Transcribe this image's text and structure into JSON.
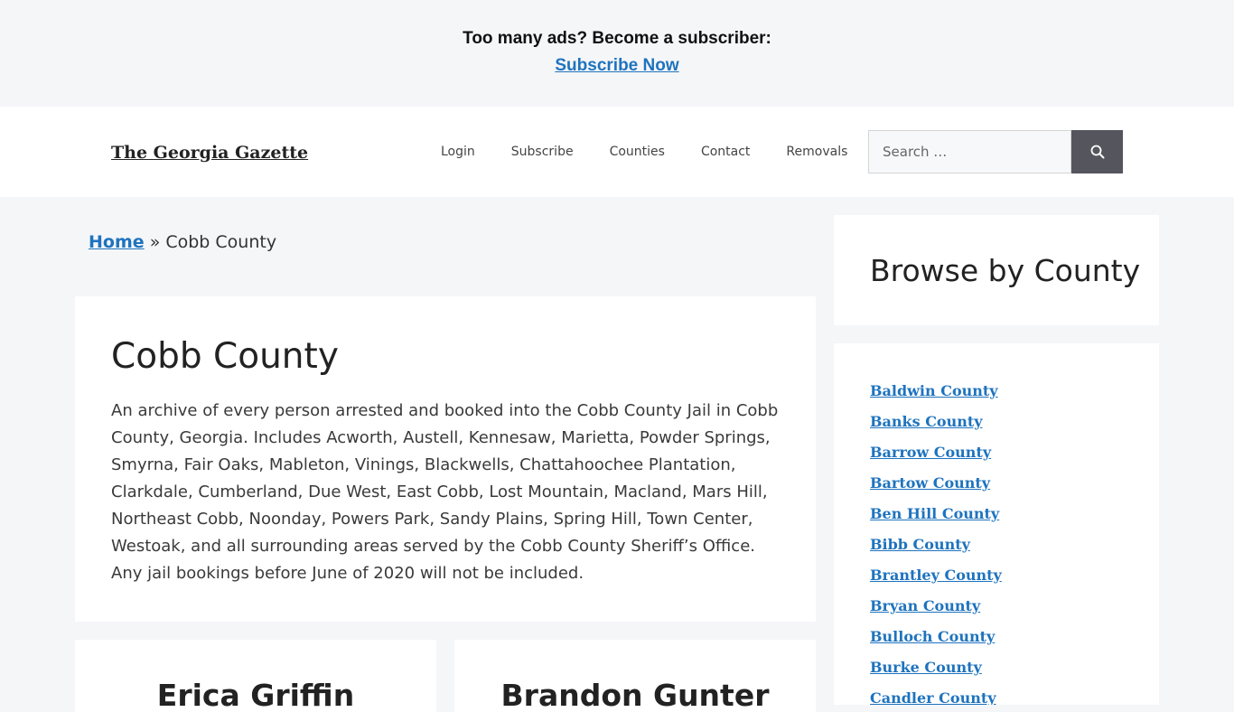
{
  "banner": {
    "text": "Too many ads? Become a subscriber:",
    "link_label": "Subscribe Now"
  },
  "header": {
    "site_title": "The Georgia Gazette",
    "nav": [
      "Login",
      "Subscribe",
      "Counties",
      "Contact",
      "Removals"
    ],
    "search_placeholder": "Search …",
    "search_icon": "search-icon"
  },
  "breadcrumb": {
    "home_label": "Home",
    "separator": "»",
    "current": "Cobb County"
  },
  "main": {
    "title": "Cobb County",
    "description": "An archive of every person arrested and booked into the Cobb County Jail in Cobb County, Georgia. Includes Acworth, Austell, Kennesaw, Marietta, Powder Springs, Smyrna, Fair Oaks, Mableton, Vinings, Blackwells, Chattahoochee Plantation, Clarkdale, Cumberland, Due West, East Cobb, Lost Mountain, Macland, Mars Hill, Northeast Cobb, Noonday, Powers Park, Sandy Plains, Spring Hill, Town Center, Westoak, and all surrounding areas served by the Cobb County Sheriff’s Office. Any jail bookings before June of 2020 will not be included."
  },
  "posts": [
    {
      "name": "Erica Griffin"
    },
    {
      "name": "Brandon Gunter"
    }
  ],
  "sidebar": {
    "title": "Browse by County",
    "counties": [
      "Baldwin County",
      "Banks County",
      "Barrow County",
      "Bartow County",
      "Ben Hill County",
      "Bibb County",
      "Brantley County",
      "Bryan County",
      "Bulloch County",
      "Burke County",
      "Candler County"
    ]
  },
  "colors": {
    "link": "#1e73be",
    "search_button": "#55555e",
    "page_background": "#f5f6f8"
  }
}
